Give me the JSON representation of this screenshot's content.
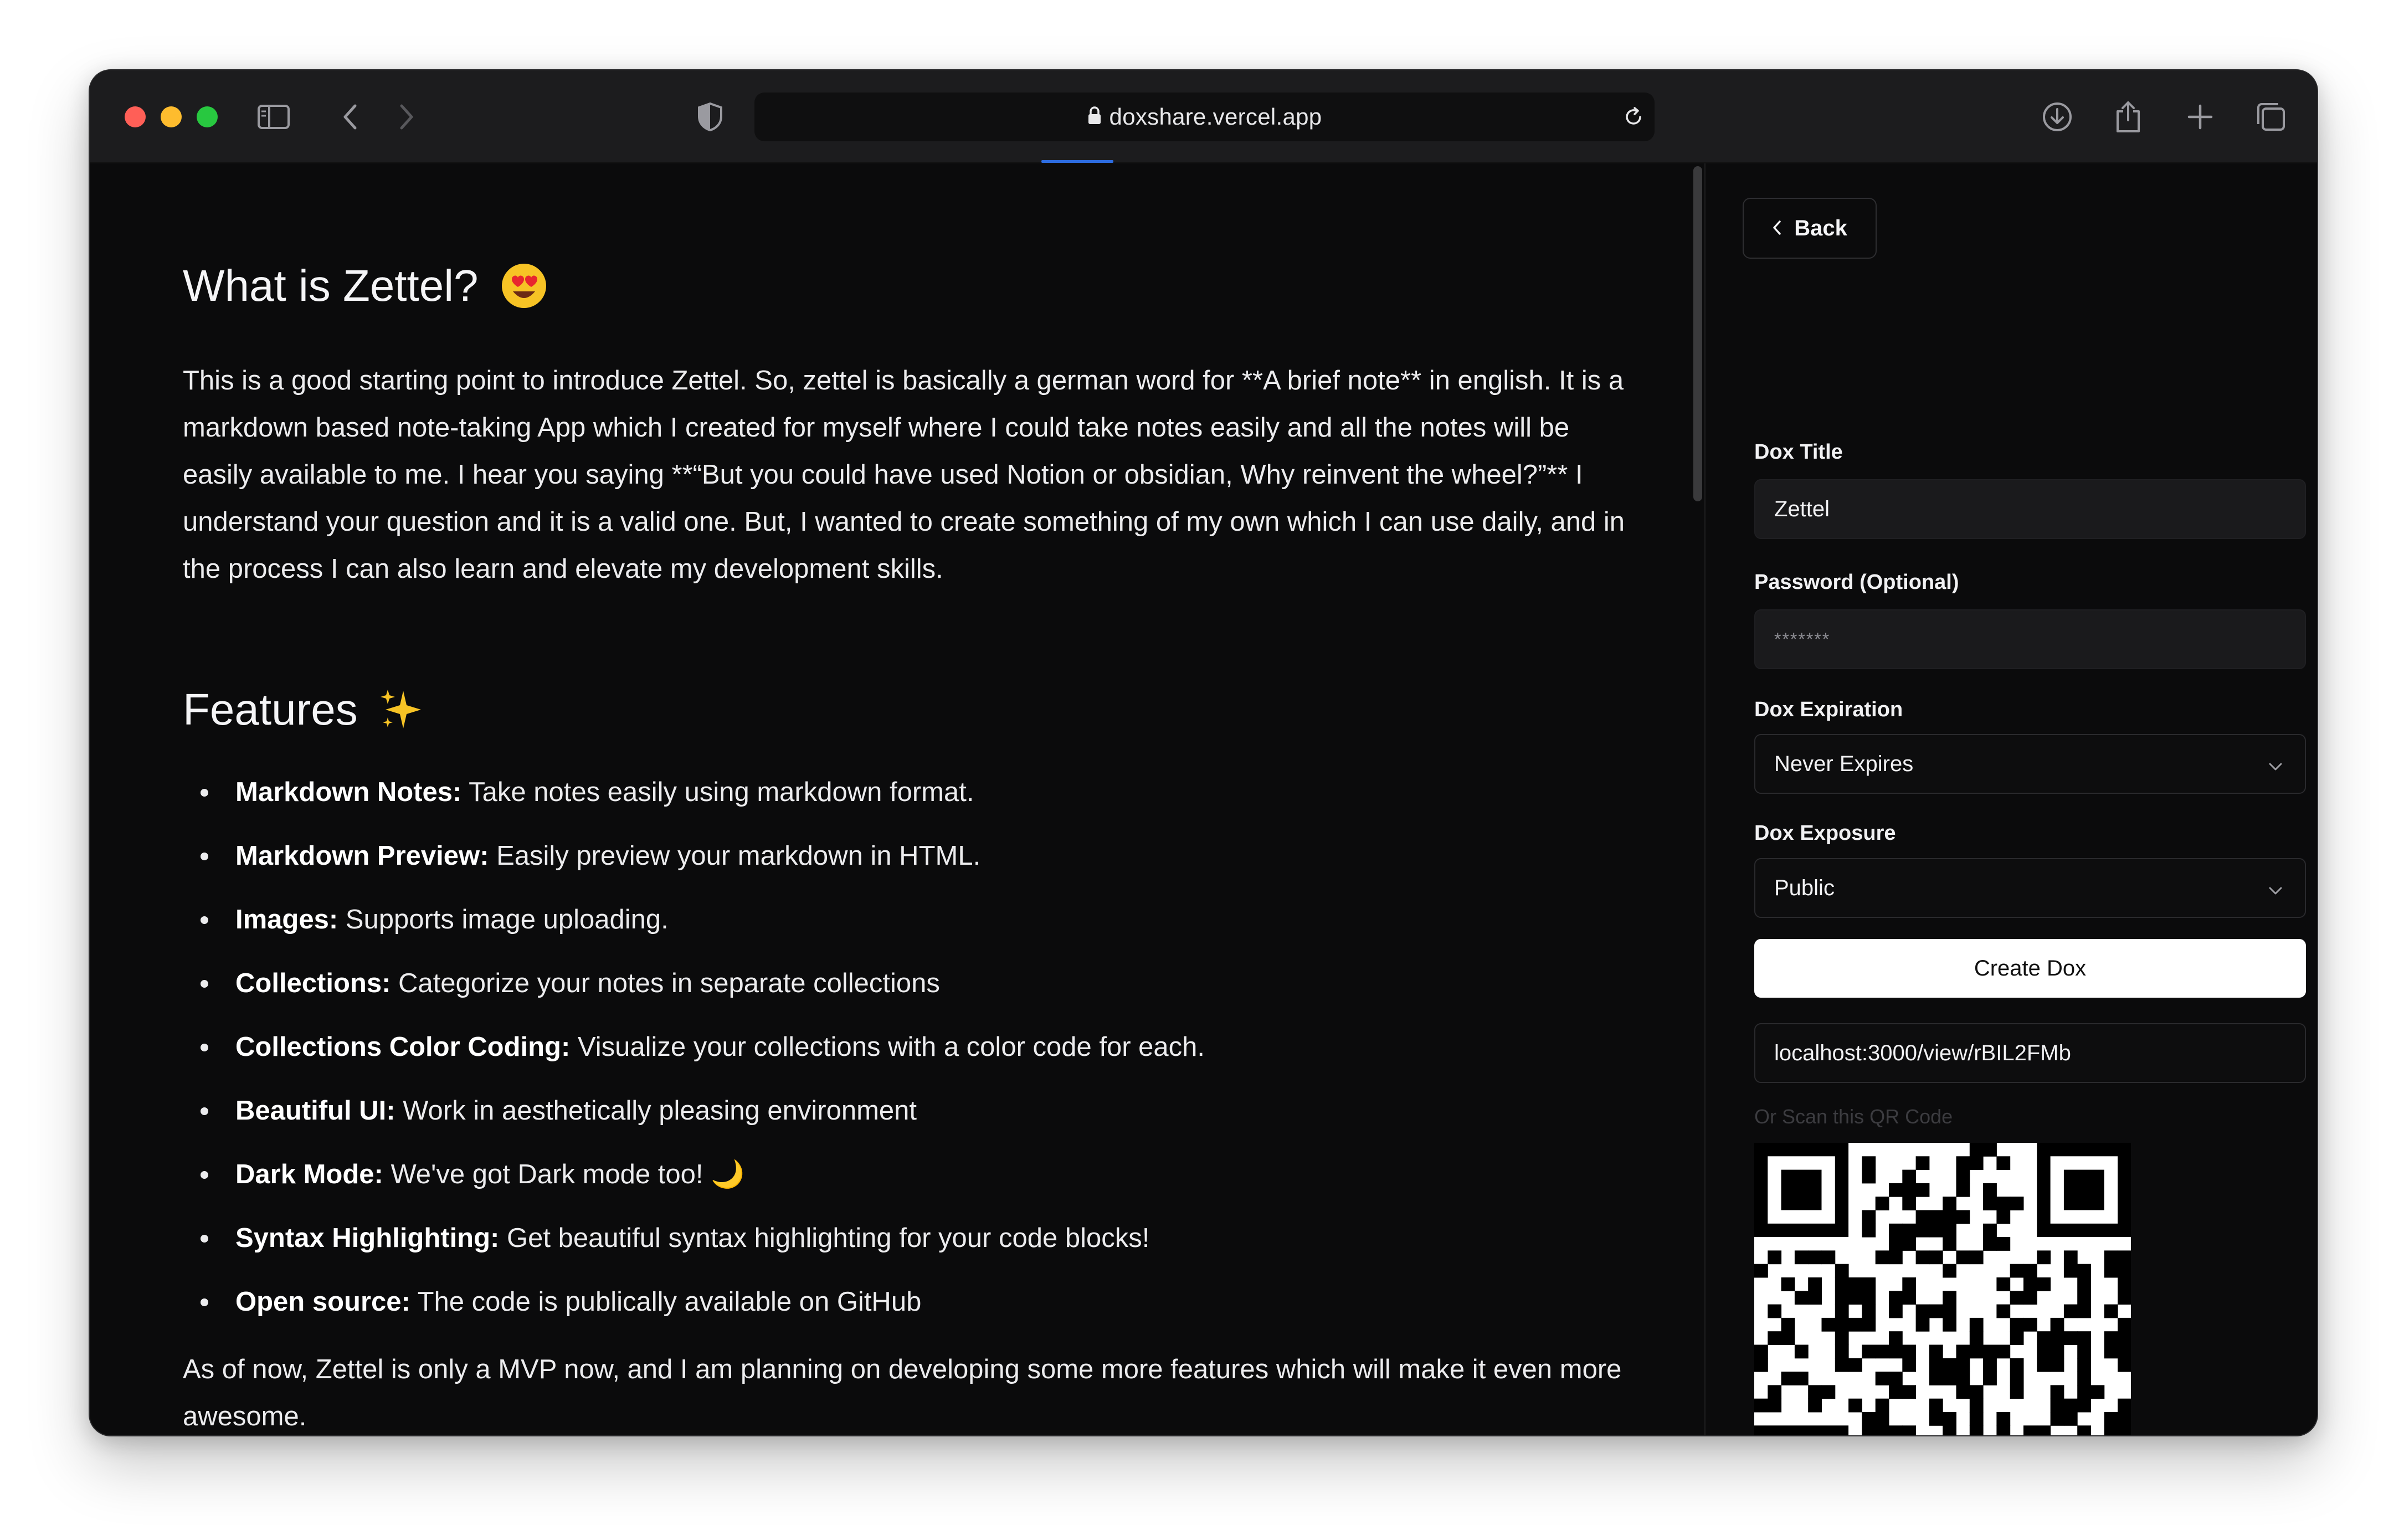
{
  "browser": {
    "url": "doxshare.vercel.app"
  },
  "article": {
    "title": "What is Zettel?",
    "intro": "This is a good starting point to introduce Zettel. So, zettel is basically a german word for **A brief note** in english. It is a markdown based note-taking App which I created for myself where I could take notes easily and all the notes will be easily available to me. I hear you saying **“But you could have used Notion or obsidian, Why reinvent the wheel?”** I understand your question and it is a valid one. But, I wanted to create something of my own which I can use daily, and in the process I can also learn and elevate my development skills.",
    "features_heading": "Features",
    "features": [
      {
        "term": "Markdown Notes:",
        "desc": " Take notes easily using markdown format."
      },
      {
        "term": "Markdown Preview:",
        "desc": " Easily preview your markdown in HTML."
      },
      {
        "term": "Images:",
        "desc": " Supports image uploading."
      },
      {
        "term": "Collections:",
        "desc": " Categorize your notes in separate collections"
      },
      {
        "term": "Collections Color Coding:",
        "desc": " Visualize your collections with a color code for each."
      },
      {
        "term": "Beautiful UI:",
        "desc": " Work in aesthetically pleasing environment"
      },
      {
        "term": "Dark Mode:",
        "desc": " We've got Dark mode too! 🌙"
      },
      {
        "term": "Syntax Highlighting:",
        "desc": " Get beautiful syntax highlighting for your code blocks!"
      },
      {
        "term": "Open source:",
        "desc": " The code is publically available on GitHub"
      }
    ],
    "outro": "As of now, Zettel is only a MVP now, and I am planning on developing some more features which will make it even more awesome."
  },
  "panel": {
    "back_label": "Back",
    "title_label": "Dox Title",
    "title_value": "Zettel",
    "password_label": "Password (Optional)",
    "password_value": "*******",
    "expiration_label": "Dox Expiration",
    "expiration_value": "Never Expires",
    "exposure_label": "Dox Exposure",
    "exposure_value": "Public",
    "create_label": "Create Dox",
    "share_url": "localhost:3000/view/rBIL2FMb",
    "qr_caption": "Or Scan this QR Code"
  },
  "colors": {
    "window_bg": "#0b0b0c",
    "titlebar_bg": "#1c1c1e",
    "accent_blue": "#2d6cdf"
  }
}
